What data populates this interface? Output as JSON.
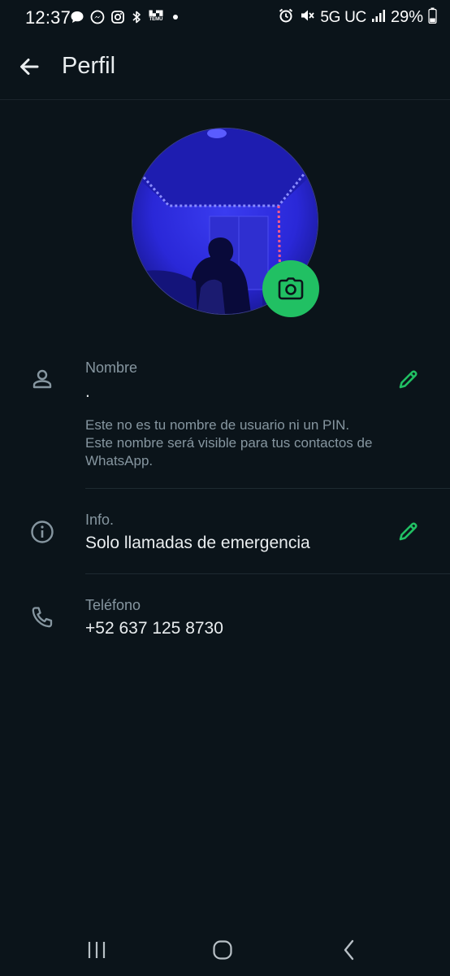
{
  "status_bar": {
    "time": "12:37",
    "temu_line1": "█▄▀█",
    "temu_line2": "TEMU",
    "network": "5G UC",
    "battery": "29%",
    "left_icons": [
      "chat-bubble-icon",
      "messenger-icon",
      "instagram-icon",
      "bluetooth-icon",
      "temu-icon",
      "dot-icon"
    ],
    "right_icons": [
      "alarm-icon",
      "mute-icon",
      "signal-icon",
      "battery-icon"
    ]
  },
  "header": {
    "title": "Perfil",
    "back_icon": "arrow-left-icon"
  },
  "profile": {
    "avatar_icon": "profile-photo",
    "camera_icon": "camera-icon",
    "accent_color": "#21c063"
  },
  "fields": {
    "name": {
      "label": "Nombre",
      "value": ".",
      "hint_lines": [
        "Este no es tu nombre de usuario ni un PIN.",
        "Este nombre será visible para tus contactos de",
        "WhatsApp."
      ],
      "icon": "person-icon",
      "edit_icon": "pencil-icon"
    },
    "about": {
      "label": "Info.",
      "value": "Solo llamadas de emergencia",
      "icon": "info-icon",
      "edit_icon": "pencil-icon"
    },
    "phone": {
      "label": "Teléfono",
      "value": "+52 637 125 8730",
      "icon": "phone-icon"
    }
  },
  "nav": {
    "recents_icon": "recents-icon",
    "home_icon": "home-icon",
    "back_icon": "back-chevron-icon"
  },
  "colors": {
    "background": "#0b141a",
    "text_primary": "#e9edef",
    "text_secondary": "#8696a0",
    "accent": "#21c063"
  }
}
